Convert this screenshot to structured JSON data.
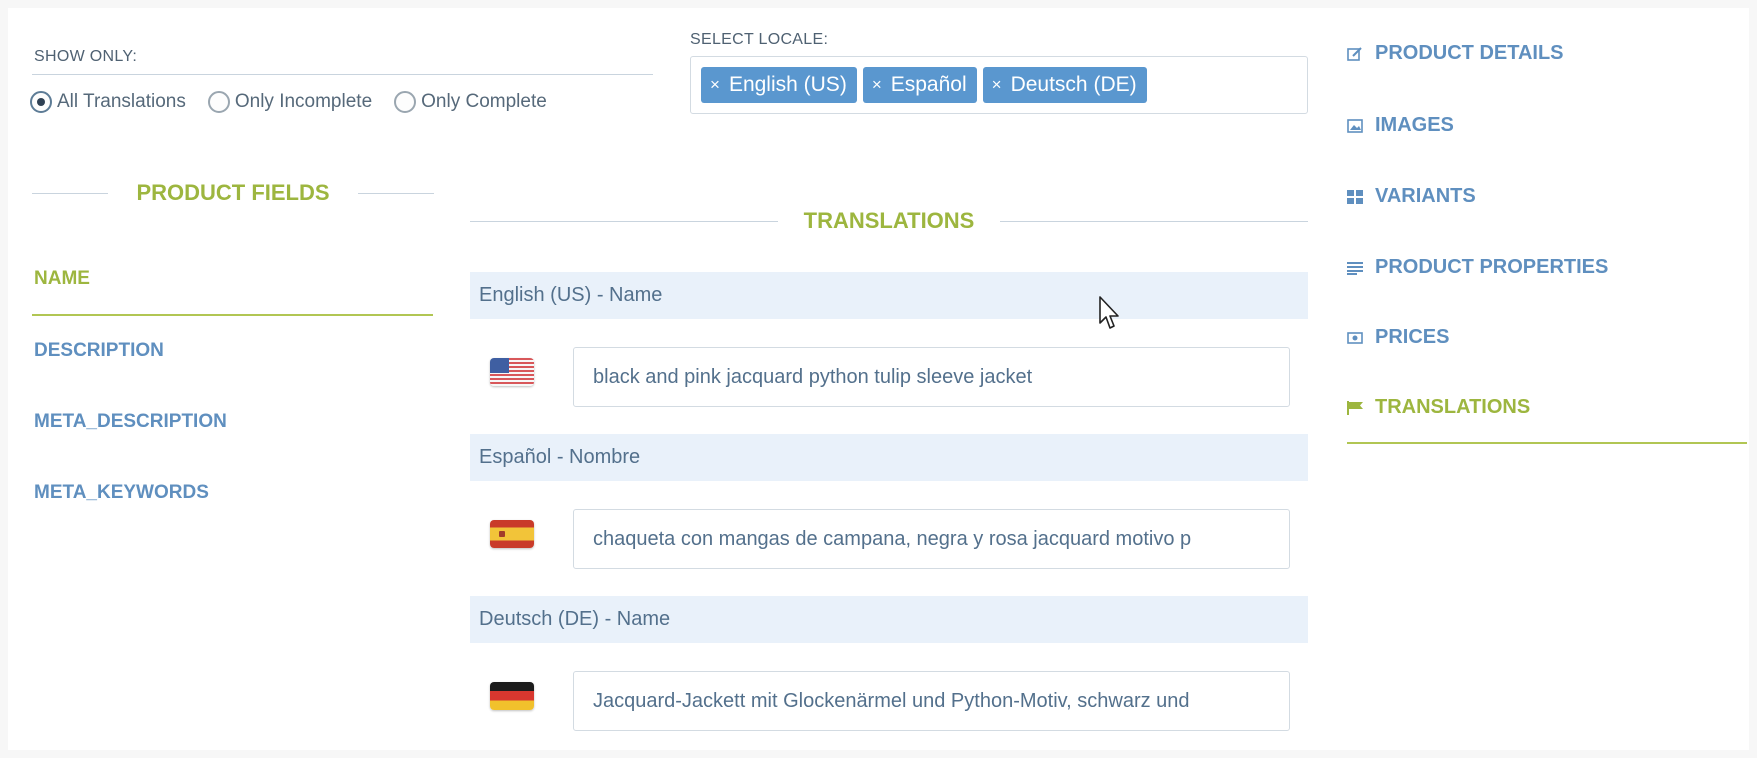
{
  "filter": {
    "label": "SHOW ONLY:",
    "options": [
      "All Translations",
      "Only Incomplete",
      "Only Complete"
    ],
    "selected": "All Translations"
  },
  "locale": {
    "label": "SELECT LOCALE:",
    "tags": [
      "English (US)",
      "Español",
      "Deutsch (DE)"
    ],
    "remove_symbol": "×"
  },
  "product_fields": {
    "heading": "PRODUCT FIELDS",
    "items": [
      "NAME",
      "DESCRIPTION",
      "META_DESCRIPTION",
      "META_KEYWORDS"
    ],
    "active": "NAME"
  },
  "translations": {
    "heading": "TRANSLATIONS",
    "entries": [
      {
        "label": "English (US) - Name",
        "flag": "us-flag-icon",
        "value": "black and pink jacquard python tulip sleeve jacket"
      },
      {
        "label": "Español - Nombre",
        "flag": "spain-flag-icon",
        "value": "chaqueta con mangas de campana, negra y rosa jacquard motivo p"
      },
      {
        "label": "Deutsch (DE) - Name",
        "flag": "germany-flag-icon",
        "value": "Jacquard-Jackett mit Glockenärmel und Python-Motiv, schwarz und"
      }
    ]
  },
  "nav": {
    "items": [
      {
        "label": "PRODUCT DETAILS",
        "icon": "edit-icon"
      },
      {
        "label": "IMAGES",
        "icon": "image-icon"
      },
      {
        "label": "VARIANTS",
        "icon": "grid-icon"
      },
      {
        "label": "PRODUCT PROPERTIES",
        "icon": "list-icon"
      },
      {
        "label": "PRICES",
        "icon": "money-icon"
      },
      {
        "label": "TRANSLATIONS",
        "icon": "flag-icon"
      }
    ],
    "active": "TRANSLATIONS"
  },
  "colors": {
    "accent_green": "#9db63f",
    "link_blue": "#5f8fbf",
    "tag_blue": "#5a97cf",
    "section_bar": "#e9f1fa"
  }
}
